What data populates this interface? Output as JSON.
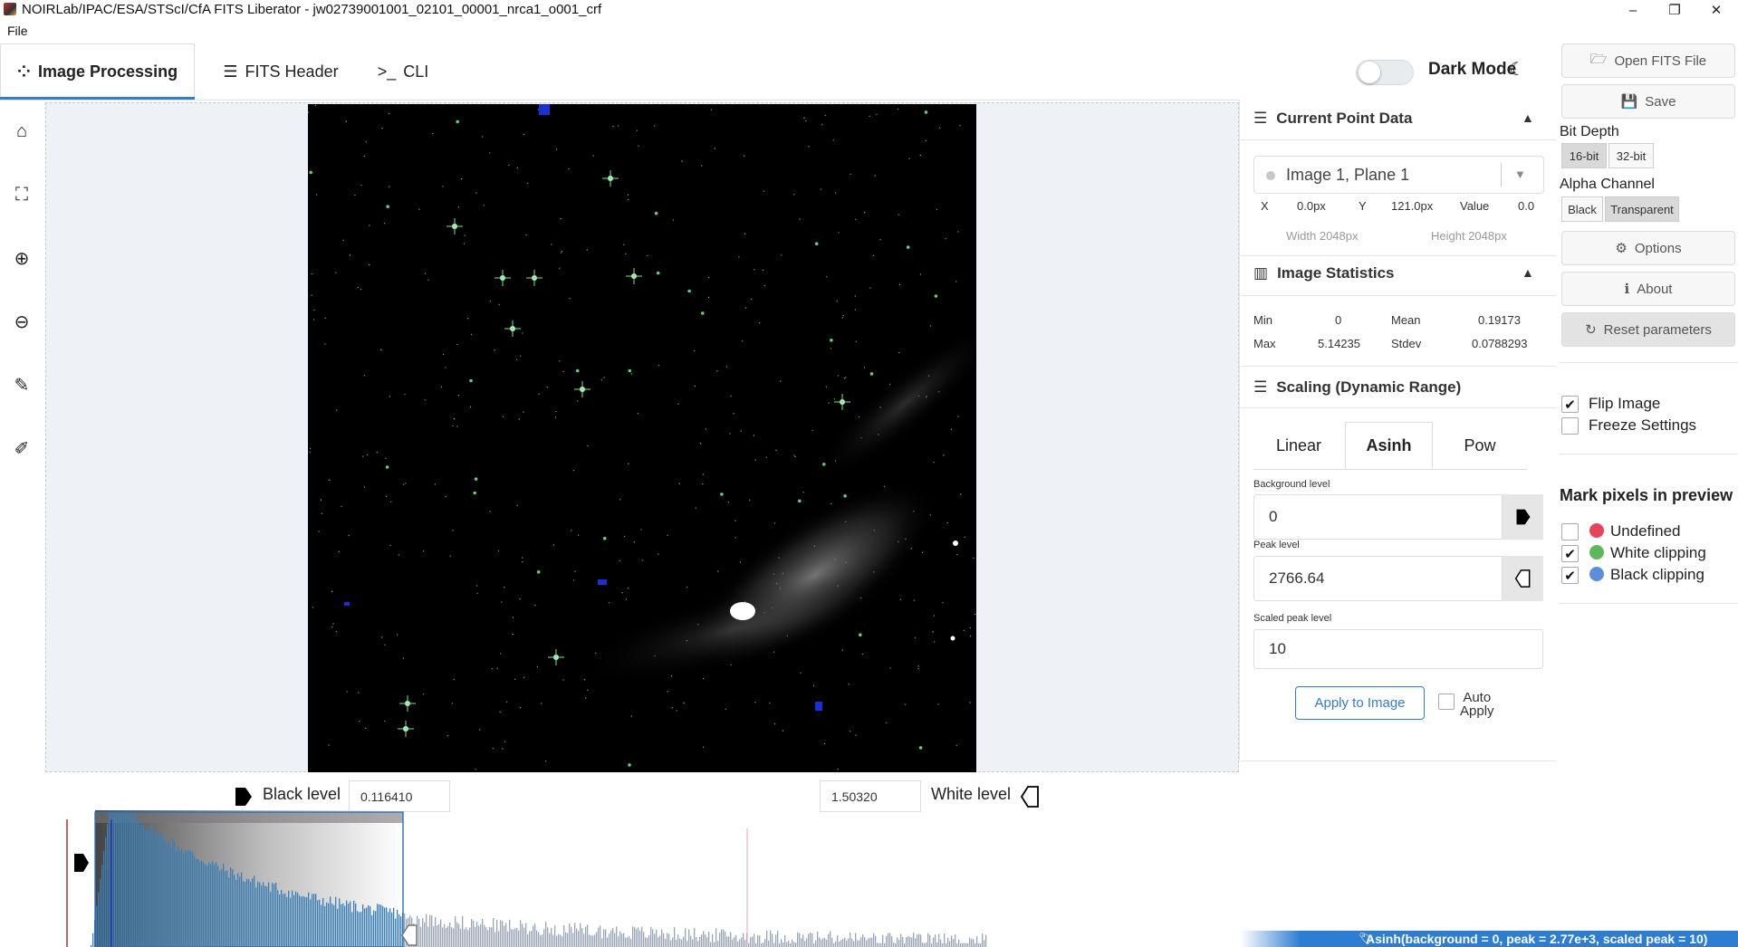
{
  "window": {
    "title": "NOIRLab/IPAC/ESA/STScI/CfA FITS Liberator - jw02739001001_02101_00001_nrca1_o001_crf",
    "minimize": "–",
    "maximize": "❐",
    "close": "✕"
  },
  "menu": {
    "file": "File"
  },
  "tabs": [
    {
      "label": "Image Processing",
      "icon": "⁘"
    },
    {
      "label": "FITS Header",
      "icon": "☰"
    },
    {
      "label": "CLI",
      "icon": ">_"
    }
  ],
  "dark_mode": {
    "label": "Dark Mode",
    "icon": "☾"
  },
  "toolbar": {
    "home": "⌂",
    "fit": "⛶",
    "zoom_in": "⊕",
    "zoom_out": "⊖",
    "picker_black": "✎",
    "picker_white": "✐"
  },
  "histogram": {
    "black_label": "Black level",
    "black_value": "0.116410",
    "white_value": "1.50320",
    "white_label": "White level"
  },
  "current_point": {
    "title": "Current Point Data",
    "selector": "Image 1, Plane 1",
    "x_label": "X",
    "x_value": "0.0px",
    "y_label": "Y",
    "y_value": "121.0px",
    "value_label": "Value",
    "value": "0.0",
    "width": "Width 2048px",
    "height": "Height 2048px"
  },
  "stats": {
    "title": "Image Statistics",
    "min_label": "Min",
    "min": "0",
    "mean_label": "Mean",
    "mean": "0.19173",
    "max_label": "Max",
    "max": "5.14235",
    "stdev_label": "Stdev",
    "stdev": "0.0788293"
  },
  "scaling": {
    "title": "Scaling (Dynamic Range)",
    "tabs": [
      "Linear",
      "Asinh",
      "Pow"
    ],
    "background_label": "Background level",
    "background_value": "0",
    "peak_label": "Peak level",
    "peak_value": "2766.64",
    "scaled_peak_label": "Scaled peak level",
    "scaled_peak_value": "10",
    "apply": "Apply to Image",
    "auto_apply_1": "Auto",
    "auto_apply_2": "Apply"
  },
  "sidebar": {
    "open": "Open FITS File",
    "save": "Save",
    "bit_depth_label": "Bit Depth",
    "bit16": "16-bit",
    "bit32": "32-bit",
    "alpha_label": "Alpha Channel",
    "alpha_black": "Black",
    "alpha_transparent": "Transparent",
    "options": "Options",
    "about": "About",
    "reset": "Reset parameters",
    "flip": "Flip Image",
    "freeze": "Freeze Settings",
    "mark_title": "Mark pixels in preview",
    "undefined": "Undefined",
    "white_clip": "White clipping",
    "black_clip": "Black clipping"
  },
  "colors": {
    "accent": "#2d7dd2",
    "undefined": "#e8435a",
    "white_clip": "#5cb85c",
    "black_clip": "#5b8fdb"
  },
  "status": "Asinh(background = 0, peak = 2.77e+3, scaled peak = 10)"
}
